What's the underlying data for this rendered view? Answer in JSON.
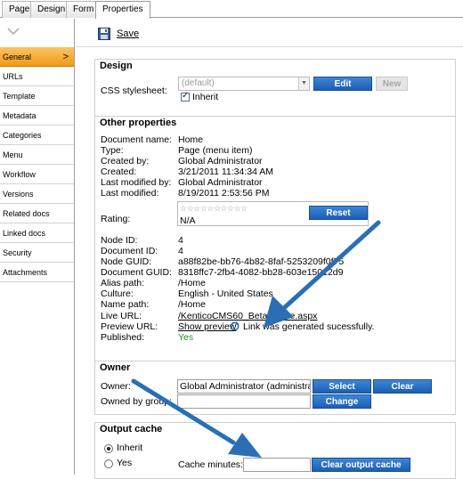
{
  "tabs": [
    "Page",
    "Design",
    "Form",
    "Properties"
  ],
  "sidebar": {
    "items": [
      "General",
      "URLs",
      "Template",
      "Metadata",
      "Categories",
      "Menu",
      "Workflow",
      "Versions",
      "Related docs",
      "Linked docs",
      "Security",
      "Attachments"
    ],
    "active": "General"
  },
  "toolbar": {
    "save_label": "Save"
  },
  "design": {
    "title": "Design",
    "css_label": "CSS stylesheet:",
    "css_value": "(default)",
    "inherit_label": "Inherit",
    "edit_label": "Edit",
    "new_label": "New"
  },
  "other": {
    "title": "Other properties",
    "rows": [
      {
        "label": "Document name:",
        "value": "Home"
      },
      {
        "label": "Type:",
        "value": "Page (menu item)"
      },
      {
        "label": "Created by:",
        "value": "Global Administrator"
      },
      {
        "label": "Created:",
        "value": "3/21/2011 11:34:34 AM"
      },
      {
        "label": "Last modified by:",
        "value": "Global Administrator"
      },
      {
        "label": "Last modified:",
        "value": "8/19/2011 2:53:56 PM"
      }
    ],
    "rating_label": "Rating:",
    "rating_stars": "☆☆☆☆☆☆☆☆☆☆",
    "rating_value": "N/A",
    "reset_label": "Reset",
    "rows2": [
      {
        "label": "Node ID:",
        "value": "4"
      },
      {
        "label": "Document ID:",
        "value": "4"
      },
      {
        "label": "Node GUID:",
        "value": "a88f82be-bb76-4b82-8faf-5253209f0f75"
      },
      {
        "label": "Document GUID:",
        "value": "8318ffc7-2fb4-4082-bb28-603e15012d9"
      },
      {
        "label": "Alias path:",
        "value": "/Home"
      },
      {
        "label": "Culture:",
        "value": "English - United States"
      },
      {
        "label": "Name path:",
        "value": "/Home"
      }
    ],
    "live_url_label": "Live URL:",
    "live_url": "/KenticoCMS60_Beta/Home.aspx",
    "preview_url_label": "Preview URL:",
    "show_preview": "Show preview",
    "preview_msg": "Link was generated sucessfully.",
    "published_label": "Published:",
    "published_value": "Yes"
  },
  "owner": {
    "title": "Owner",
    "owner_label": "Owner:",
    "owner_value": "Global Administrator (administrato",
    "select_label": "Select",
    "clear_label": "Clear",
    "group_label": "Owned by group:",
    "change_label": "Change"
  },
  "cache": {
    "title": "Output cache",
    "inherit_label": "Inherit",
    "yes_label": "Yes",
    "minutes_label": "Cache minutes:",
    "clear_cache_label": "Clear output cache"
  },
  "colors": {
    "accent": "#f29a18",
    "button": "#2a6bc0",
    "arrow": "#2a6fb5",
    "published": "#1a9a1a"
  }
}
